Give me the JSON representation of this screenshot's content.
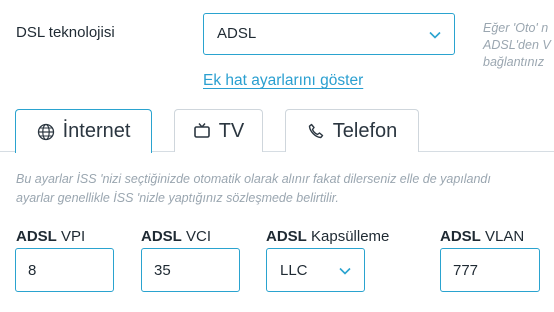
{
  "dsl": {
    "label": "DSL teknolojisi",
    "selected": "ADSL",
    "hint_lines": [
      "Eğer 'Oto' n",
      "ADSL'den V",
      "bağlantınız"
    ]
  },
  "advanced_link": "Ek hat ayarlarını göster",
  "tabs": [
    {
      "label": "İnternet",
      "icon": "globe-icon",
      "active": true
    },
    {
      "label": "TV",
      "icon": "tv-icon",
      "active": false
    },
    {
      "label": "Telefon",
      "icon": "phone-icon",
      "active": false
    }
  ],
  "info_lines": [
    "Bu ayarlar İSS 'nizi seçtiğinizde otomatik olarak alınır fakat dilerseniz elle de yapılandı",
    "ayarlar genellikle İSS 'nizle yaptığınız sözleşmede belirtilir."
  ],
  "fields": {
    "vpi": {
      "label_bold": "ADSL",
      "label_rest": " VPI",
      "value": "8"
    },
    "vci": {
      "label_bold": "ADSL",
      "label_rest": " VCI",
      "value": "35"
    },
    "encapsulation": {
      "label_bold": "ADSL",
      "label_rest": " Kapsülleme",
      "value": "LLC"
    },
    "vlan": {
      "label_bold": "ADSL",
      "label_rest": " VLAN",
      "value": "777"
    }
  },
  "colors": {
    "accent": "#2aa3cf",
    "muted_text": "#9aa6b0",
    "text": "#1f2a33"
  }
}
